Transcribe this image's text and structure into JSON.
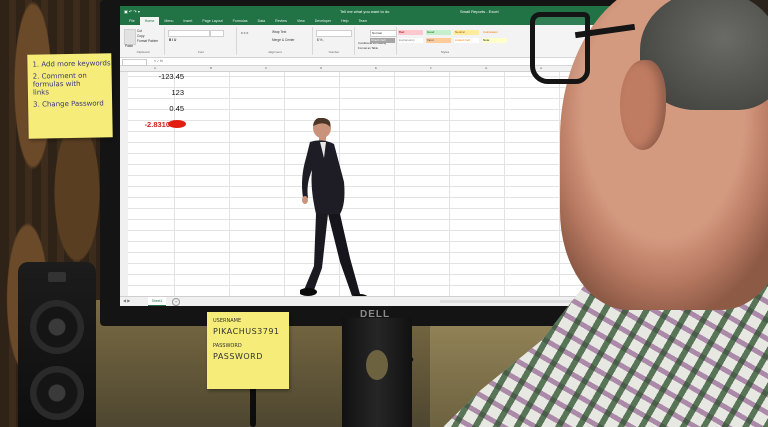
{
  "excel": {
    "title": "Small Reports - Excel",
    "tell_me": "Tell me what you want to do",
    "tabs": [
      "File",
      "Home",
      "Menu",
      "Insert",
      "Page Layout",
      "Formulas",
      "Data",
      "Review",
      "View",
      "Developer",
      "Help",
      "Team"
    ],
    "active_tab": "Home",
    "ribbon": {
      "clipboard": "Clipboard",
      "font": "Font",
      "alignment": "Alignment",
      "number": "Number",
      "styles": "Styles",
      "cut": "Cut",
      "copy": "Copy",
      "format_painter": "Format Painter",
      "paste": "Paste",
      "wrap_text": "Wrap Text",
      "merge_center": "Merge & Center",
      "conditional_formatting": "Conditional Formatting",
      "format_as_table": "Format as Table",
      "style_names": [
        "Normal",
        "Bad",
        "Good",
        "Neutral",
        "Calculation",
        "Check Cell",
        "Explanatory",
        "Input",
        "Linked Cell",
        "Note"
      ]
    },
    "cells": [
      "-123.45",
      "123",
      "0.45",
      "-2.8310"
    ],
    "sheet_tab": "Sheet1",
    "add_sheet": "+"
  },
  "notes": {
    "left": [
      "1. Add more keywords",
      "2. Comment on",
      "   formulas with",
      "   links",
      "3. Change Password"
    ],
    "bottom": {
      "username_label": "USERNAME",
      "username": "PIKACHUS3791",
      "password_label": "PASSWORD",
      "password": "PASSWORD"
    }
  },
  "monitor_brand": "DELL",
  "colors": {
    "excel_green": "#217346",
    "negative_red": "#d61f1f",
    "sticky_yellow": "#f6ec7a"
  }
}
